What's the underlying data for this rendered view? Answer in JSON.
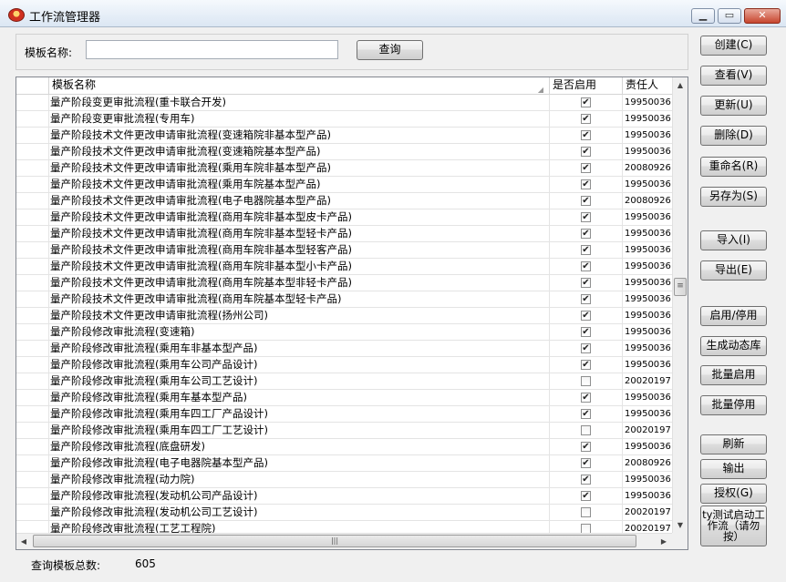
{
  "window": {
    "title": "工作流管理器",
    "minimize": "▁",
    "restore": "▭",
    "close": "✕"
  },
  "search": {
    "label": "模板名称:",
    "value": "",
    "placeholder": "",
    "button": "查询"
  },
  "grid": {
    "columns": [
      "模板名称",
      "是否启用",
      "责任人"
    ],
    "rows": [
      {
        "name": "量产阶段变更审批流程(重卡联合开发)",
        "enabled": true,
        "owner": "19950036"
      },
      {
        "name": "量产阶段变更审批流程(专用车)",
        "enabled": true,
        "owner": "19950036"
      },
      {
        "name": "量产阶段技术文件更改申请审批流程(变速箱院非基本型产品)",
        "enabled": true,
        "owner": "19950036"
      },
      {
        "name": "量产阶段技术文件更改申请审批流程(变速箱院基本型产品)",
        "enabled": true,
        "owner": "19950036"
      },
      {
        "name": "量产阶段技术文件更改申请审批流程(乘用车院非基本型产品)",
        "enabled": true,
        "owner": "20080926"
      },
      {
        "name": "量产阶段技术文件更改申请审批流程(乘用车院基本型产品)",
        "enabled": true,
        "owner": "19950036"
      },
      {
        "name": "量产阶段技术文件更改申请审批流程(电子电器院基本型产品)",
        "enabled": true,
        "owner": "20080926"
      },
      {
        "name": "量产阶段技术文件更改申请审批流程(商用车院非基本型皮卡产品)",
        "enabled": true,
        "owner": "19950036"
      },
      {
        "name": "量产阶段技术文件更改申请审批流程(商用车院非基本型轻卡产品)",
        "enabled": true,
        "owner": "19950036"
      },
      {
        "name": "量产阶段技术文件更改申请审批流程(商用车院非基本型轻客产品)",
        "enabled": true,
        "owner": "19950036"
      },
      {
        "name": "量产阶段技术文件更改申请审批流程(商用车院非基本型小卡产品)",
        "enabled": true,
        "owner": "19950036"
      },
      {
        "name": "量产阶段技术文件更改申请审批流程(商用车院基本型非轻卡产品)",
        "enabled": true,
        "owner": "19950036"
      },
      {
        "name": "量产阶段技术文件更改申请审批流程(商用车院基本型轻卡产品)",
        "enabled": true,
        "owner": "19950036"
      },
      {
        "name": "量产阶段技术文件更改申请审批流程(扬州公司)",
        "enabled": true,
        "owner": "19950036"
      },
      {
        "name": "量产阶段修改审批流程(变速箱)",
        "enabled": true,
        "owner": "19950036"
      },
      {
        "name": "量产阶段修改审批流程(乘用车非基本型产品)",
        "enabled": true,
        "owner": "19950036"
      },
      {
        "name": "量产阶段修改审批流程(乘用车公司产品设计)",
        "enabled": true,
        "owner": "19950036"
      },
      {
        "name": "量产阶段修改审批流程(乘用车公司工艺设计)",
        "enabled": false,
        "owner": "20020197"
      },
      {
        "name": "量产阶段修改审批流程(乘用车基本型产品)",
        "enabled": true,
        "owner": "19950036"
      },
      {
        "name": "量产阶段修改审批流程(乘用车四工厂产品设计)",
        "enabled": true,
        "owner": "19950036"
      },
      {
        "name": "量产阶段修改审批流程(乘用车四工厂工艺设计)",
        "enabled": false,
        "owner": "20020197"
      },
      {
        "name": "量产阶段修改审批流程(底盘研发)",
        "enabled": true,
        "owner": "19950036"
      },
      {
        "name": "量产阶段修改审批流程(电子电器院基本型产品)",
        "enabled": true,
        "owner": "20080926"
      },
      {
        "name": "量产阶段修改审批流程(动力院)",
        "enabled": true,
        "owner": "19950036"
      },
      {
        "name": "量产阶段修改审批流程(发动机公司产品设计)",
        "enabled": true,
        "owner": "19950036"
      },
      {
        "name": "量产阶段修改审批流程(发动机公司工艺设计)",
        "enabled": false,
        "owner": "20020197"
      },
      {
        "name": "量产阶段修改审批流程(工艺工程院)",
        "enabled": false,
        "owner": "20020197"
      }
    ]
  },
  "actions": [
    "创建(C)",
    "查看(V)",
    "更新(U)",
    "删除(D)",
    "重命名(R)",
    "另存为(S)",
    "导入(I)",
    "导出(E)",
    "启用/停用",
    "生成动态库",
    "批量启用",
    "批量停用",
    "刷新",
    "输出",
    "授权(G)",
    "ty测试启动工作流（请勿按）"
  ],
  "status": {
    "label": "查询模板总数:",
    "value": "605"
  }
}
